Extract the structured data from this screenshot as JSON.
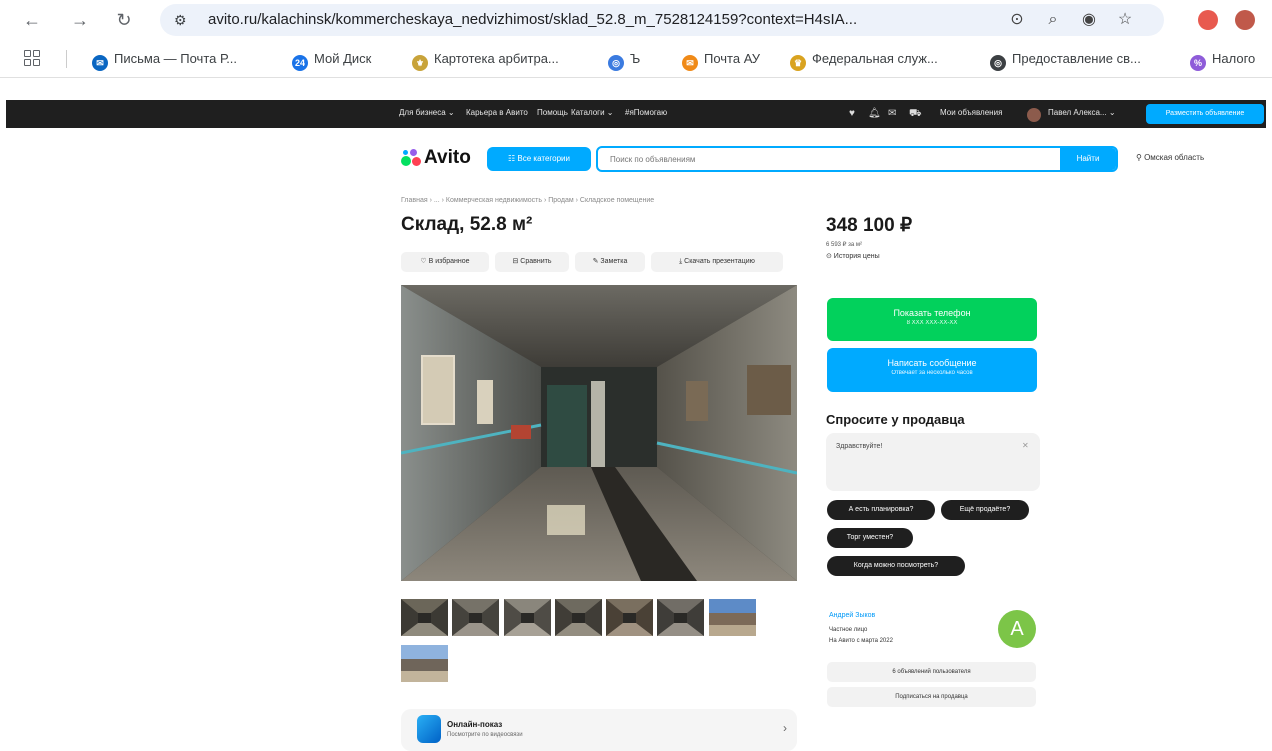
{
  "browser": {
    "url": "avito.ru/kalachinsk/kommercheskaya_nedvizhimost/sklad_52.8_m_7528124159?context=H4sIA...",
    "bookmarks": [
      {
        "label": "Письма — Почта Р...",
        "color": "#0a66c2",
        "glyph": "✉"
      },
      {
        "label": "Мой Диск",
        "color": "#1a73e8",
        "glyph": "24"
      },
      {
        "label": "Картотека арбитра...",
        "color": "#c8a33a",
        "glyph": "⚜"
      },
      {
        "label": "Ъ",
        "color": "#3b7be0",
        "glyph": "◎"
      },
      {
        "label": "Почта АУ",
        "color": "#f08a18",
        "glyph": "✉"
      },
      {
        "label": "Федеральная служ...",
        "color": "#d9a320",
        "glyph": "♛"
      },
      {
        "label": "Предоставление св...",
        "color": "#3c4043",
        "glyph": "◎"
      },
      {
        "label": "Налого",
        "color": "#8e5cd9",
        "glyph": "%"
      }
    ]
  },
  "topbar": {
    "links": [
      "Для бизнеса ⌄",
      "Карьера в Авито",
      "Помощь",
      "Каталоги ⌄",
      "#яПомогаю"
    ],
    "my_ads": "Мои объявления",
    "user": "Павел Алекса... ⌄",
    "post_button": "Разместить объявление"
  },
  "header": {
    "logo": "Avito",
    "categories_button": "☷ Все категории",
    "search_placeholder": "Поиск по объявлениям",
    "search_button": "Найти",
    "region": "⚲ Омская область"
  },
  "listing": {
    "breadcrumb": "Главная › ... › Коммерческая недвижимость › Продам › Складское помещение",
    "title": "Склад, 52.8 м²",
    "actions": [
      "♡ В избранное",
      "⊟ Сравнить",
      "✎ Заметка",
      "⤓ Скачать презентацию"
    ],
    "online_title": "Онлайн-показ",
    "online_sub": "Посмотрите по видеосвязи"
  },
  "sidebar": {
    "price": "348 100 ₽",
    "price_per_m": "6 593 ₽ за м²",
    "price_history": "⊙ История цены",
    "phone_button": "Показать телефон",
    "phone_mask": "8 XXX XXX-XX-XX",
    "message_button": "Написать сообщение",
    "message_sub": "Отвечает за несколько часов",
    "ask_title": "Спросите у продавца",
    "ask_text": "Здравствуйте!",
    "chips": [
      "А есть планировка?",
      "Ещё продаёте?",
      "Торг уместен?",
      "Когда можно посмотреть?"
    ],
    "seller_name": "Андрей Зыков",
    "seller_type": "Частное лицо",
    "seller_since": "На Авито с марта 2022",
    "seller_initial": "А",
    "seller_ads_button": "6 объявлений пользователя",
    "subscribe_button": "Подписаться на продавца"
  },
  "colors": {
    "accent": "#00aaff",
    "green": "#02d15c",
    "dark": "#1f1f1f"
  }
}
